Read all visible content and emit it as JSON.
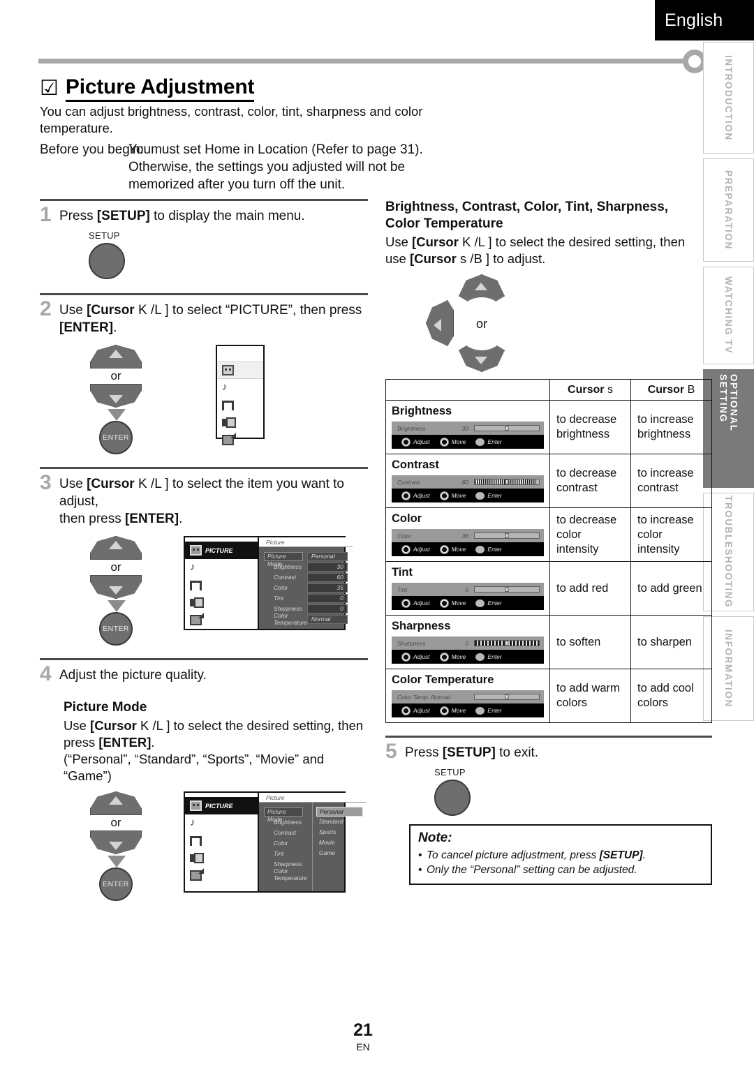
{
  "header": {
    "language": "English"
  },
  "side_tabs": [
    {
      "label": "INTRODUCTION",
      "active": false
    },
    {
      "label": "PREPARATION",
      "active": false
    },
    {
      "label": "WATCHING TV",
      "active": false
    },
    {
      "label": "OPTIONAL SETTING",
      "active": true
    },
    {
      "label": "TROUBLESHOOTING",
      "active": false
    },
    {
      "label": "INFORMATION",
      "active": false
    }
  ],
  "title": {
    "check": "☑",
    "text": "Picture Adjustment"
  },
  "intro": "You can adjust brightness, contrast, color, tint, sharpness and color temperature.",
  "before": {
    "label": "Before you begin:",
    "overlap": "You",
    "line1": "must set  Home  in  Location  (Refer to page  31).",
    "line2": "Otherwise, the settings you adjusted will not be",
    "line3": "memorized after you turn off the unit."
  },
  "steps": {
    "s1": {
      "num": "1",
      "pre": "Press ",
      "key": "[SETUP]",
      "post": " to display the main menu.",
      "button_caption": "SETUP"
    },
    "s2": {
      "num": "2",
      "a": "Use ",
      "k1": "[Cursor",
      "k2": "K /L ]",
      "b": " to select “PICTURE”, then press",
      "c": "[ENTER]",
      "d": ".",
      "or": "or",
      "enter": "ENTER"
    },
    "s3": {
      "num": "3",
      "a": "Use ",
      "k1": "[Cursor",
      "k2": "K /L ]",
      "b": " to select the item you want to adjust,",
      "c": "then press ",
      "d": "[ENTER]",
      "e": ".",
      "or": "or",
      "enter": "ENTER"
    },
    "s4": {
      "num": "4",
      "text": "Adjust the picture quality."
    },
    "s5": {
      "num": "5",
      "pre": "Press ",
      "key": "[SETUP]",
      "post": " to exit.",
      "button_caption": "SETUP"
    }
  },
  "picture_mode": {
    "heading": "Picture Mode",
    "line1a": "Use ",
    "line1k1": "[Cursor",
    "line1k2": "K /L ]",
    "line1b": " to select the desired setting, then",
    "line2a": "press ",
    "line2k": "[ENTER]",
    "line2b": ".",
    "line3": "(“Personal”, “Standard”, “Sports”, “Movie” and “Game”)",
    "or": "or",
    "enter": "ENTER"
  },
  "osd_step3": {
    "title": "Picture",
    "selected_icon_label": "PICTURE",
    "rows": [
      {
        "label": "Picture Mode",
        "value": "Personal",
        "highlighted": true,
        "wordy": true
      },
      {
        "label": "Brightness",
        "value": "30",
        "highlighted": false,
        "wordy": false
      },
      {
        "label": "Contrast",
        "value": "60",
        "highlighted": false,
        "wordy": false
      },
      {
        "label": "Color",
        "value": "35",
        "highlighted": false,
        "wordy": false
      },
      {
        "label": "Tint",
        "value": "0",
        "highlighted": false,
        "wordy": false
      },
      {
        "label": "Sharpness",
        "value": "0",
        "highlighted": false,
        "wordy": false
      },
      {
        "label": "Color Temperature",
        "value": "Normal",
        "highlighted": false,
        "wordy": true
      }
    ]
  },
  "osd_step4": {
    "title": "Picture",
    "selected_icon_label": "PICTURE",
    "rows": [
      {
        "label": "Picture Mode",
        "highlighted": true
      },
      {
        "label": "Brightness",
        "highlighted": false
      },
      {
        "label": "Contrast",
        "highlighted": false
      },
      {
        "label": "Color",
        "highlighted": false
      },
      {
        "label": "Tint",
        "highlighted": false
      },
      {
        "label": "Sharpness",
        "highlighted": false
      },
      {
        "label": "Color Temperature",
        "highlighted": false
      }
    ],
    "options": [
      {
        "label": "Personal",
        "selected": true
      },
      {
        "label": "Standard",
        "selected": false
      },
      {
        "label": "Sports",
        "selected": false
      },
      {
        "label": "Movie",
        "selected": false
      },
      {
        "label": "Game",
        "selected": false
      }
    ]
  },
  "right": {
    "heading_l1": "Brightness, Contrast, Color, Tint, Sharpness,",
    "heading_l2": "Color Temperature",
    "body_a": "Use ",
    "body_k1": "[Cursor",
    "body_k2": "K /L ]",
    "body_b": " to select the desired setting, then",
    "body_c": "use ",
    "body_k3": "[Cursor",
    "body_k4": "s /B ]",
    "body_d": " to adjust.",
    "pad_or": "or"
  },
  "table": {
    "col_left_header": "",
    "col_mid_header_bold": "Cursor",
    "col_mid_header_sym": "s",
    "col_right_header_bold": "Cursor",
    "col_right_header_sym": "B",
    "osd_keys": {
      "adjust": "Adjust",
      "move": "Move",
      "enter": "Enter"
    },
    "rows": [
      {
        "title": "Brightness",
        "osd_name": "Brightness",
        "osd_value": "30",
        "fill": "none",
        "left": "to decrease brightness",
        "right": "to increase brightness"
      },
      {
        "title": "Contrast",
        "osd_name": "Contrast",
        "osd_value": "60",
        "fill": "dense",
        "left": "to decrease contrast",
        "right": "to increase contrast"
      },
      {
        "title": "Color",
        "osd_name": "Color",
        "osd_value": "36",
        "fill": "none",
        "left": "to decrease color intensity",
        "right": "to increase color intensity"
      },
      {
        "title": "Tint",
        "osd_name": "Tint",
        "osd_value": "0",
        "fill": "none",
        "left": "to add red",
        "right": "to add green"
      },
      {
        "title": "Sharpness",
        "osd_name": "Sharpness",
        "osd_value": "0",
        "fill": "seg",
        "left": "to soften",
        "right": "to sharpen"
      },
      {
        "title": "Color Temperature",
        "osd_name": "Color Temp. Normal",
        "osd_value": "",
        "fill": "none",
        "left": "to add warm colors",
        "right": "to add cool colors"
      }
    ]
  },
  "note": {
    "heading": "Note:",
    "items_pre": [
      "To cancel picture adjustment, press ",
      "Only the “Personal” setting can be adjusted."
    ],
    "item1_key": "[SETUP]",
    "item1_post": "."
  },
  "footer": {
    "page": "21",
    "lang_code": "EN"
  }
}
